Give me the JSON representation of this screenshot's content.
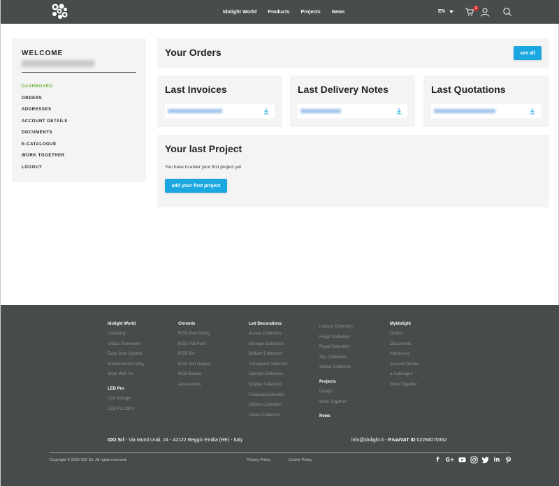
{
  "header": {
    "nav": [
      "Idolight World",
      "Products",
      "Projects",
      "News"
    ],
    "language": "EN",
    "cart_count": "1"
  },
  "sidebar": {
    "welcome": "WELCOME",
    "items": [
      {
        "label": "DASHBOARD",
        "active": true
      },
      {
        "label": "ORDERS"
      },
      {
        "label": "ADDRESSES"
      },
      {
        "label": "ACCOUNT DETAILS"
      },
      {
        "label": "DOCUMENTS"
      },
      {
        "label": "E-CATALOGUE"
      },
      {
        "label": "WORK TOGETHER"
      },
      {
        "label": "LOGOUT"
      }
    ]
  },
  "orders": {
    "title": "Your Orders",
    "see_all": "see all"
  },
  "invoices": {
    "title": "Last Invoices"
  },
  "delivery": {
    "title": "Last Delivery Notes"
  },
  "quotations": {
    "title": "Last Quotations"
  },
  "project": {
    "title": "Your last Project",
    "empty": "You have to enter your first project yet",
    "button": "add your first project"
  },
  "footer": {
    "col1": {
      "heading": "Idolight World",
      "items": [
        "Company",
        "Virtual Showroom",
        "Easy Joint System",
        "Enviromental Policy",
        "Work With Us"
      ],
      "heading2": "LED Pro",
      "items2": [
        "Low Voltage",
        "LED Pro 230V"
      ]
    },
    "col2": {
      "heading": "Chromix",
      "items": [
        "RGB Pixel String",
        "RGB Flat Pixel",
        "RGB Bar",
        "RGB Soft Display",
        "RGB Bauble",
        "Accessories"
      ]
    },
    "col3": {
      "heading": "Led Decorations",
      "items": [
        "Aurora Collection",
        "Baroque Collection",
        "Brilliant Collection",
        "Candyland Collection",
        "Decoart Collection",
        "Display Collection",
        "Fantasia Collection",
        "Giftbox Collection",
        "Green Collection"
      ]
    },
    "col4": {
      "items": [
        "Leisure Collection",
        "Regal Collection",
        "Royal Collection",
        "Sky Collection",
        "Winter Collection"
      ],
      "heading2": "Projects",
      "items2": [
        "Design",
        "Work Together"
      ],
      "heading3": "News"
    },
    "col5": {
      "heading": "MyIdolight",
      "items": [
        "Orders",
        "Documents",
        "Addresses",
        "Account Details",
        "e-Catalogue",
        "Work Together"
      ]
    },
    "company": "IDO Srl",
    "address": " - Via Monti Urali, 24 - 42122 Reggio Emilia (RE) - Italy",
    "email": "info@idolight.it - ",
    "vat_label": "P.Iva/VAT ID",
    "vat": " 02284070352",
    "copyright": "Copyright © 2019 IDO Srl. All rights reserved.",
    "privacy": "Privacy Policy",
    "cookie": "Cookie Policy",
    "socials": [
      "facebook-icon",
      "google-plus-icon",
      "youtube-icon",
      "instagram-icon",
      "twitter-icon",
      "linkedin-icon",
      "pinterest-icon"
    ]
  },
  "colors": {
    "accent": "#1ba7e0",
    "active": "#6cb033",
    "header_bg": "#474c4d",
    "footer_bg": "#464b4c",
    "card_bg": "#f4f4f4"
  }
}
